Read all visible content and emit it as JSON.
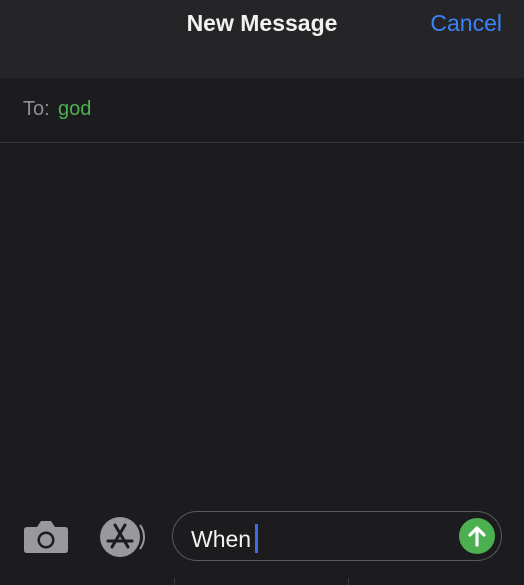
{
  "header": {
    "title": "New Message",
    "cancel_label": "Cancel"
  },
  "recipient_row": {
    "to_label": "To:",
    "recipient": "god"
  },
  "compose": {
    "message_text": "When",
    "camera_icon": "camera-icon",
    "apps_icon": "app-store-icon",
    "send_icon": "send-arrow-icon"
  },
  "colors": {
    "background": "#1c1c1e",
    "header_bg": "#252527",
    "accent_blue": "#3b82f6",
    "recipient_green": "#4caf50",
    "send_button_green": "#4caf50",
    "caret_blue": "#3b6cf0"
  }
}
